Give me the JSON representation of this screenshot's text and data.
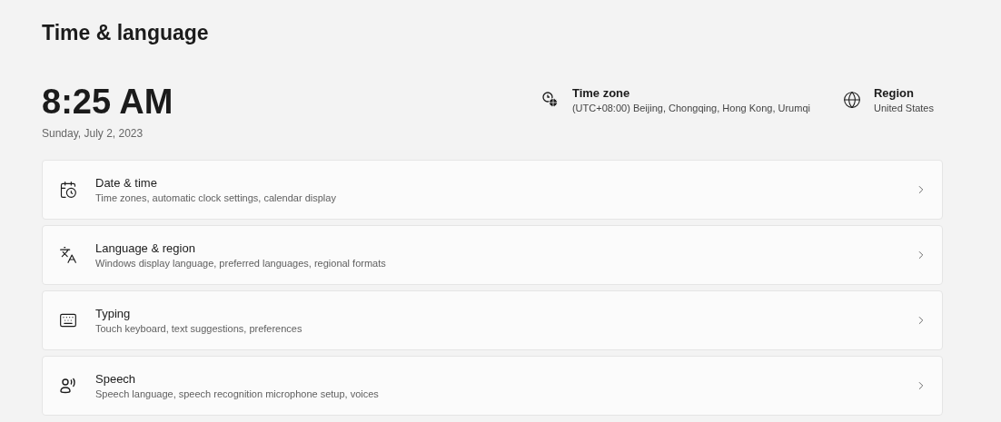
{
  "page_title": "Time & language",
  "clock": {
    "time": "8:25 AM",
    "date": "Sunday, July 2, 2023"
  },
  "info": [
    {
      "label": "Time zone",
      "value": "(UTC+08:00) Beijing, Chongqing, Hong Kong, Urumqi"
    },
    {
      "label": "Region",
      "value": "United States"
    }
  ],
  "settings": [
    {
      "title": "Date & time",
      "description": "Time zones, automatic clock settings, calendar display"
    },
    {
      "title": "Language & region",
      "description": "Windows display language, preferred languages, regional formats"
    },
    {
      "title": "Typing",
      "description": "Touch keyboard, text suggestions, preferences"
    },
    {
      "title": "Speech",
      "description": "Speech language, speech recognition microphone setup, voices"
    }
  ]
}
